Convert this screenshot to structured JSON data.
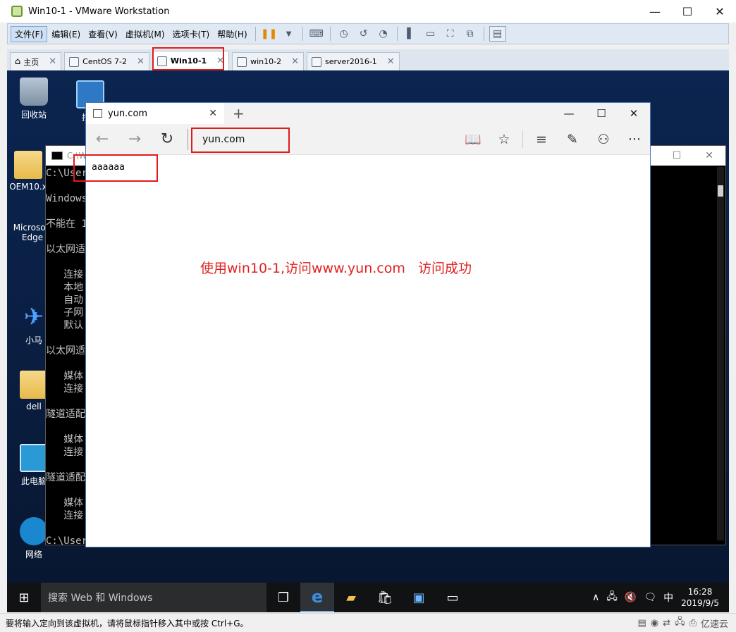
{
  "vm_window": {
    "title": "Win10-1 - VMware Workstation",
    "controls": {
      "minimize": "—",
      "maximize": "☐",
      "close": "✕"
    }
  },
  "menubar": {
    "items": [
      {
        "label": "文件(F)"
      },
      {
        "label": "编辑(E)"
      },
      {
        "label": "查看(V)"
      },
      {
        "label": "虚拟机(M)"
      },
      {
        "label": "选项卡(T)"
      },
      {
        "label": "帮助(H)"
      }
    ]
  },
  "vm_tabs": [
    {
      "label": "主页",
      "icon": "home-icon"
    },
    {
      "label": "CentOS 7-2",
      "icon": "vm-icon"
    },
    {
      "label": "Win10-1",
      "icon": "vm-icon",
      "active": true
    },
    {
      "label": "win10-2",
      "icon": "vm-icon"
    },
    {
      "label": "server2016-1",
      "icon": "vm-icon"
    }
  ],
  "desktop_icons": [
    {
      "label": "回收站",
      "icon": "recycle-bin-icon"
    },
    {
      "label": "控制",
      "icon": "control-panel-icon"
    },
    {
      "label": "OEM10.x",
      "icon": "folder-icon"
    },
    {
      "label": "Microsoft Edge",
      "icon": "edge-icon"
    },
    {
      "label": "小马",
      "icon": "plane-icon"
    },
    {
      "label": "dell",
      "icon": "user-folder-icon"
    },
    {
      "label": "此电脑",
      "icon": "pc-icon"
    },
    {
      "label": "网络",
      "icon": "network-icon"
    }
  ],
  "cmd": {
    "title": "C:\\W",
    "lines": [
      "C:\\User",
      "",
      "Windows",
      "",
      "不能在 1",
      "",
      "以太网适",
      "",
      "   连接",
      "   本地",
      "   自动",
      "   子网",
      "   默认",
      "",
      "以太网适",
      "",
      "   媒体",
      "   连接",
      "",
      "隧道适配",
      "",
      "   媒体",
      "   连接",
      "",
      "隧道适配",
      "",
      "   媒体",
      "   连接",
      "",
      "C:\\User"
    ]
  },
  "edge": {
    "tab_title": "yun.com",
    "address": "yun.com",
    "page_text": "aaaaaa",
    "annotation": "使用win10-1,访问www.yun.com   访问成功"
  },
  "taskbar": {
    "search_placeholder": "搜索 Web 和 Windows",
    "ime": "中",
    "time": "16:28",
    "date": "2019/9/5"
  },
  "statusbar": {
    "message": "要将输入定向到该虚拟机，请将鼠标指针移入其中或按 Ctrl+G。",
    "watermark": "亿速云"
  },
  "colors": {
    "highlight": "#e01b1b",
    "annotation": "#e02020",
    "desktop": "#0b2550"
  }
}
